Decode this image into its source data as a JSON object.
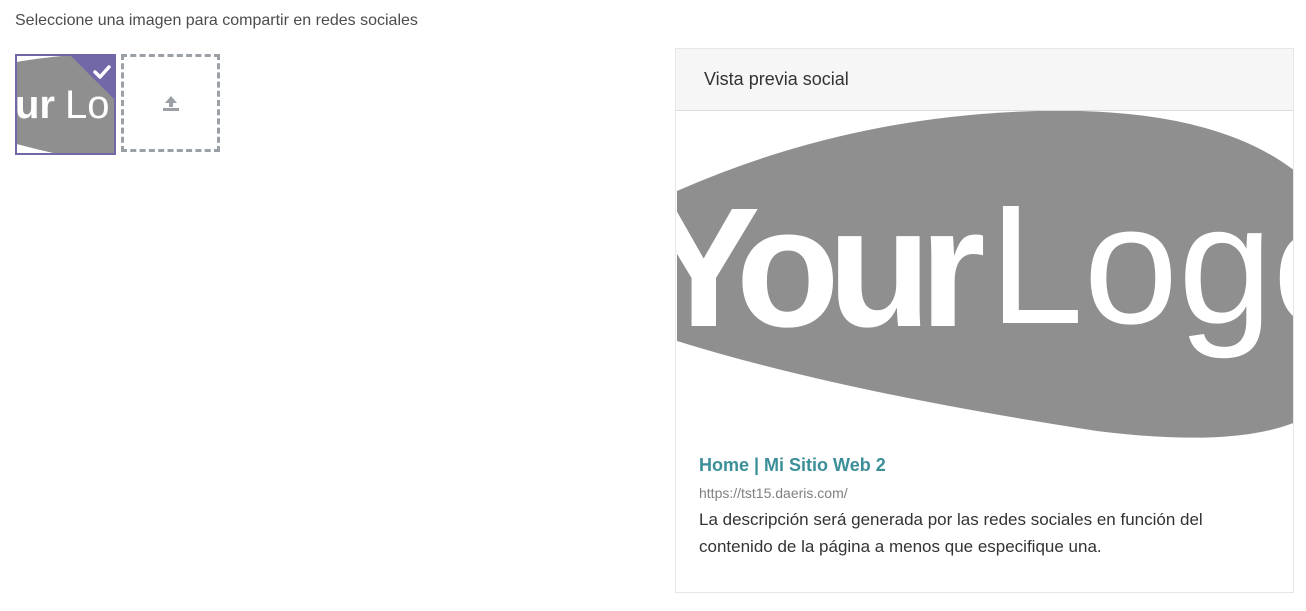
{
  "instruction": "Seleccione una imagen para compartir en redes sociales",
  "thumbnail": {
    "logo_text": "YourLogo",
    "selected": true
  },
  "upload": {
    "icon": "upload-icon"
  },
  "preview": {
    "header": "Vista previa social",
    "logo_text": "YourLogo",
    "title": "Home | Mi Sitio Web 2",
    "url": "https://tst15.daeris.com/",
    "description": "La descripción será generada por las redes sociales en función del contenido de la página a menos que especifique una."
  },
  "colors": {
    "accent": "#7268a8",
    "link": "#3b8f99",
    "logo_gray": "#8f8f8f"
  }
}
